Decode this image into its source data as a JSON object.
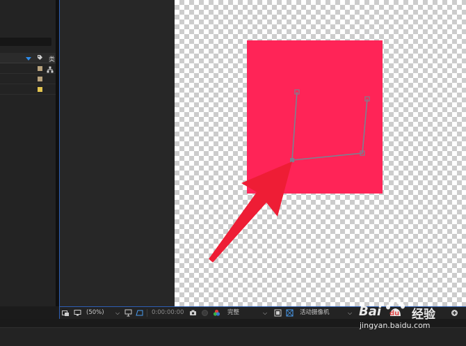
{
  "colors": {
    "accent_blue": "#2d8ceb",
    "selection_border": "#2d5fb5",
    "solid_layer": "#ff2457",
    "path_line": "#7a8290",
    "arrow": "#ee1d35",
    "label_tan": "#b8a27c",
    "label_yellow": "#e3c54f"
  },
  "project_panel": {
    "column_header_lead": "类",
    "icons": [
      "label-sort-icon",
      "tag-icon",
      "node-icon"
    ]
  },
  "viewer_toolbar": {
    "zoom": "(50%)",
    "timecode": "0:00:00:00",
    "resolution": "完整",
    "view": "活动摄像机",
    "icons": [
      "mask-toggle-icon",
      "monitor-icon",
      "zoom-dropdown-icon",
      "fit-icon",
      "roi-icon",
      "camera-icon",
      "color-channel-icon",
      "rgb-icon",
      "resolution-dropdown-icon",
      "fast-preview-icon",
      "transparency-grid-icon",
      "view-dropdown-icon",
      "add-icon"
    ]
  },
  "watermark": {
    "brand": "Bai",
    "brand_du": "du",
    "product": "经验",
    "url": "jingyan.baidu.com"
  }
}
